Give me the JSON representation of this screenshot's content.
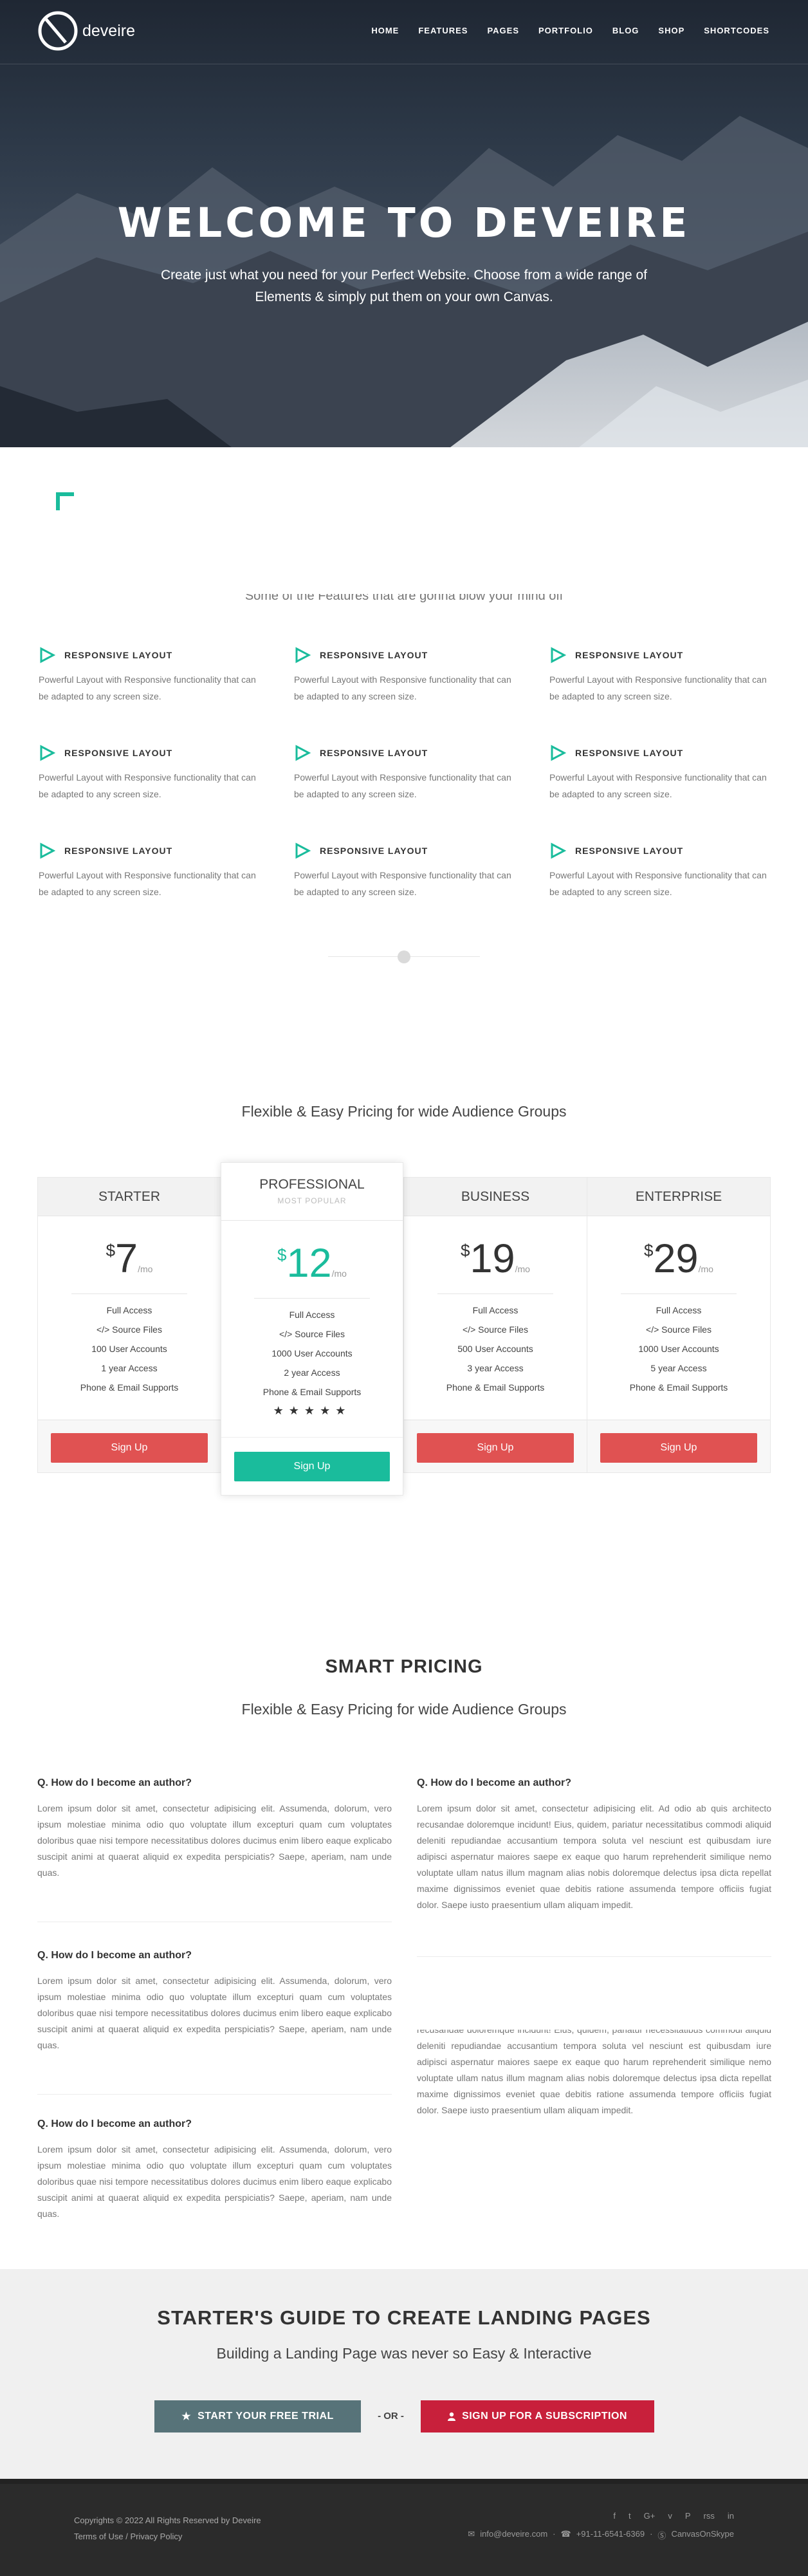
{
  "brand": {
    "name": "deveire"
  },
  "nav": {
    "items": [
      "HOME",
      "FEATURES",
      "PAGES",
      "PORTFOLIO",
      "BLOG",
      "SHOP",
      "SHORTCODES"
    ]
  },
  "hero": {
    "title": "WELCOME TO DEVEIRE",
    "subtitle": "Create just what you need for your Perfect Website. Choose from a wide range of Elements & simply put them on your own Canvas."
  },
  "features": {
    "intro": "Some of the Features that are gonna blow your mind off",
    "items": [
      {
        "title": "RESPONSIVE LAYOUT",
        "desc": "Powerful Layout with Responsive functionality that can be adapted to any screen size."
      },
      {
        "title": "RESPONSIVE LAYOUT",
        "desc": "Powerful Layout with Responsive functionality that can be adapted to any screen size."
      },
      {
        "title": "RESPONSIVE LAYOUT",
        "desc": "Powerful Layout with Responsive functionality that can be adapted to any screen size."
      },
      {
        "title": "RESPONSIVE LAYOUT",
        "desc": "Powerful Layout with Responsive functionality that can be adapted to any screen size."
      },
      {
        "title": "RESPONSIVE LAYOUT",
        "desc": "Powerful Layout with Responsive functionality that can be adapted to any screen size."
      },
      {
        "title": "RESPONSIVE LAYOUT",
        "desc": "Powerful Layout with Responsive functionality that can be adapted to any screen size."
      },
      {
        "title": "RESPONSIVE LAYOUT",
        "desc": "Powerful Layout with Responsive functionality that can be adapted to any screen size."
      },
      {
        "title": "RESPONSIVE LAYOUT",
        "desc": "Powerful Layout with Responsive functionality that can be adapted to any screen size."
      },
      {
        "title": "RESPONSIVE LAYOUT",
        "desc": "Powerful Layout with Responsive functionality that can be adapted to any screen size."
      }
    ]
  },
  "pricing": {
    "subtitle": "Flexible & Easy Pricing for wide Audience Groups",
    "plans": [
      {
        "name": "STARTER",
        "currency": "$",
        "amount": "7",
        "period": "/mo",
        "features": [
          "Full Access",
          "</> Source Files",
          "100 User Accounts",
          "1 year Access",
          "Phone & Email Supports"
        ],
        "button": "Sign Up"
      },
      {
        "name": "PROFESSIONAL",
        "badge": "MOST POPULAR",
        "currency": "$",
        "amount": "12",
        "period": "/mo",
        "features": [
          "Full Access",
          "</> Source Files",
          "1000 User Accounts",
          "2 year Access",
          "Phone & Email Supports"
        ],
        "stars": "★★★★★",
        "button": "Sign Up"
      },
      {
        "name": "BUSINESS",
        "currency": "$",
        "amount": "19",
        "period": "/mo",
        "features": [
          "Full Access",
          "</> Source Files",
          "500 User Accounts",
          "3 year Access",
          "Phone & Email Supports"
        ],
        "button": "Sign Up"
      },
      {
        "name": "ENTERPRISE",
        "currency": "$",
        "amount": "29",
        "period": "/mo",
        "features": [
          "Full Access",
          "</> Source Files",
          "1000 User Accounts",
          "5 year Access",
          "Phone & Email Supports"
        ],
        "button": "Sign Up"
      }
    ]
  },
  "faq": {
    "title": "SMART PRICING",
    "subtitle": "Flexible & Easy Pricing for wide Audience Groups",
    "items": [
      {
        "q": "Q. How do I become an author?",
        "a": "Lorem ipsum dolor sit amet, consectetur adipisicing elit. Assumenda, dolorum, vero ipsum molestiae minima odio quo voluptate illum excepturi quam cum voluptates doloribus quae nisi tempore necessitatibus dolores ducimus enim libero eaque explicabo suscipit animi at quaerat aliquid ex expedita perspiciatis? Saepe, aperiam, nam unde quas."
      },
      {
        "q": "Q. How do I become an author?",
        "a": "Lorem ipsum dolor sit amet, consectetur adipisicing elit. Ad odio ab quis architecto recusandae doloremque incidunt! Eius, quidem, pariatur necessitatibus commodi aliquid deleniti repudiandae accusantium tempora soluta vel nesciunt est quibusdam iure adipisci aspernatur maiores saepe ex eaque quo harum reprehenderit similique nemo voluptate ullam natus illum magnam alias nobis doloremque delectus ipsa dicta repellat maxime dignissimos eveniet quae debitis ratione assumenda tempore officiis fugiat dolor. Saepe iusto praesentium ullam aliquam impedit."
      },
      {
        "q": "Q. How do I become an author?",
        "a": "Lorem ipsum dolor sit amet, consectetur adipisicing elit. Assumenda, dolorum, vero ipsum molestiae minima odio quo voluptate illum excepturi quam cum voluptates doloribus quae nisi tempore necessitatibus dolores ducimus enim libero eaque explicabo suscipit animi at quaerat aliquid ex expedita perspiciatis? Saepe, aperiam, nam unde quas."
      },
      {
        "q": "",
        "a": "recusandae doloremque incidunt! Eius, quidem, pariatur necessitatibus commodi aliquid deleniti repudiandae accusantium tempora soluta vel nesciunt est quibusdam iure adipisci aspernatur maiores saepe ex eaque quo harum reprehenderit similique nemo voluptate ullam natus illum magnam alias nobis doloremque delectus ipsa dicta repellat maxime dignissimos eveniet quae debitis ratione assumenda tempore officiis fugiat dolor. Saepe iusto praesentium ullam aliquam impedit."
      },
      {
        "q": "Q. How do I become an author?",
        "a": "Lorem ipsum dolor sit amet, consectetur adipisicing elit. Assumenda, dolorum, vero ipsum molestiae minima odio quo voluptate illum excepturi quam cum voluptates doloribus quae nisi tempore necessitatibus dolores ducimus enim libero eaque explicabo suscipit animi at quaerat aliquid ex expedita perspiciatis? Saepe, aperiam, nam unde quas."
      }
    ]
  },
  "cta": {
    "title": "STARTER'S GUIDE TO CREATE LANDING PAGES",
    "subtitle": "Building a Landing Page was never so Easy & Interactive",
    "trial_label": "START YOUR FREE TRIAL",
    "or_label": "- OR -",
    "subscribe_label": "SIGN UP FOR A SUBSCRIPTION"
  },
  "footer": {
    "copyright": "Copyrights © 2022 All Rights Reserved by Deveire",
    "terms": "Terms of Use",
    "privacy": "Privacy Policy",
    "separator": "/",
    "socials": [
      "f",
      "t",
      "G+",
      "v",
      "P",
      "rss",
      "in"
    ],
    "email": "info@deveire.com",
    "phone": "+91-11-6541-6369",
    "skype": "CanvasOnSkype",
    "dot": "·"
  },
  "colors": {
    "accent": "#1abc9c",
    "signup_red": "#e05252",
    "trial": "#577379",
    "subscribe": "#c8203b"
  }
}
